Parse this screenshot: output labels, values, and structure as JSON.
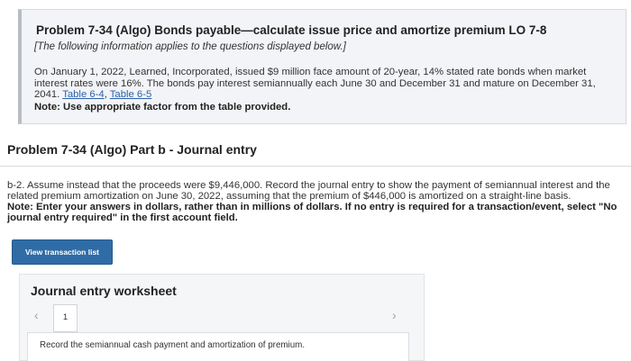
{
  "problem": {
    "title": "Problem 7-34 (Algo) Bonds payable—calculate issue price and amortize premium LO 7-8",
    "info": "[The following information applies to the questions displayed below.]",
    "paragraph": "On January 1, 2022, Learned, Incorporated, issued $9 million face amount of 20-year, 14% stated rate bonds when market interest rates were 16%. The bonds pay interest semiannually each June 30 and December 31 and mature on December 31, 2041.",
    "link1": "Table 6-4",
    "link_sep": ", ",
    "link2": "Table 6-5",
    "note": "Note: Use appropriate factor from the table provided."
  },
  "part": {
    "title": "Problem 7-34 (Algo) Part b - Journal entry",
    "task_label": "b-2.",
    "task_text": " Assume instead that the proceeds were $9,446,000. Record the journal entry to show the payment of semiannual interest and the related premium amortization on June 30, 2022, assuming that the premium of $446,000 is amortized on a straight-line basis.",
    "note": "Note: Enter your answers in dollars, rather than in millions of dollars. If no entry is required for a transaction/event, select \"No journal entry required\" in the first account field."
  },
  "buttons": {
    "view_transaction_list": "View transaction list"
  },
  "worksheet": {
    "title": "Journal entry worksheet",
    "prev_icon": "‹",
    "next_icon": "›",
    "page_number": "1",
    "instruction": "Record the semiannual cash payment and amortization of premium."
  },
  "colors": {
    "button_blue": "#2f6ca6",
    "link_blue": "#2a62a8"
  }
}
